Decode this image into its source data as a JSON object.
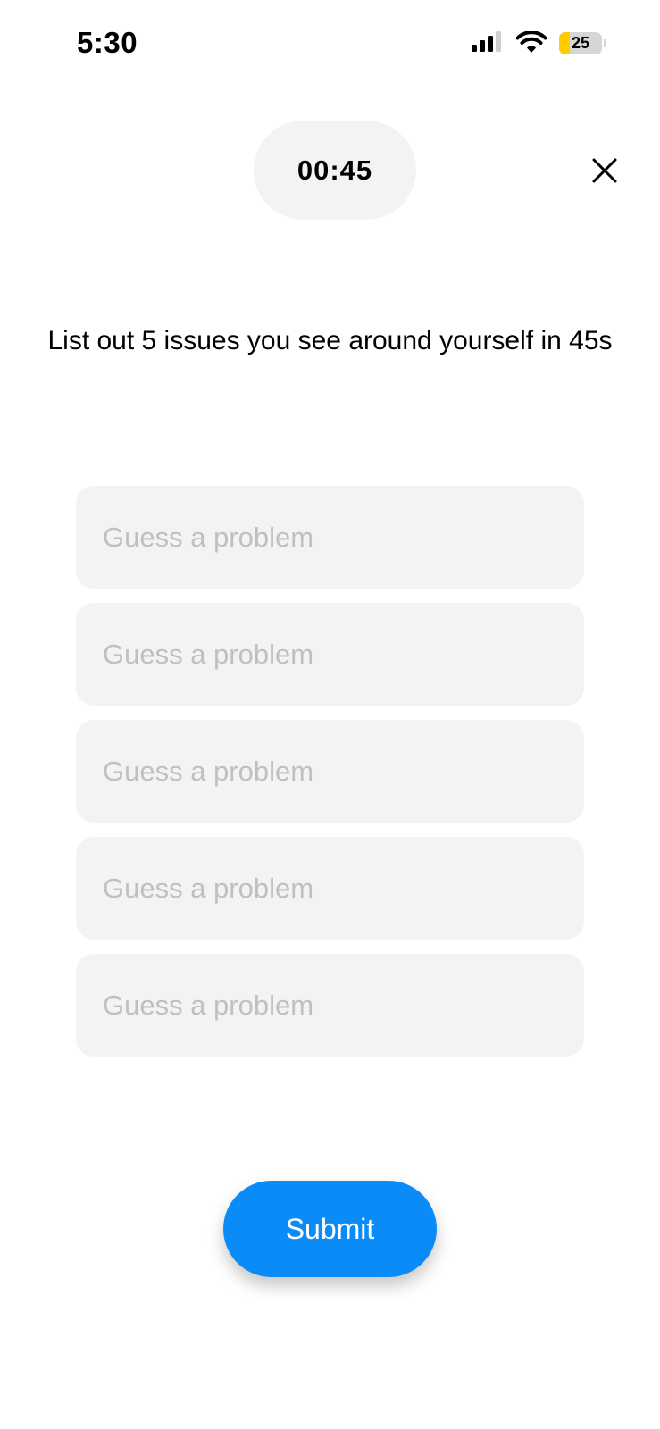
{
  "status_bar": {
    "time": "5:30",
    "signal_icon": "cellular-signal-icon",
    "wifi_icon": "wifi-icon",
    "battery_percent": 25,
    "battery_label": "25",
    "battery_color": "#ffcc00"
  },
  "timer": {
    "label": "00:45"
  },
  "close": {
    "icon": "close-icon"
  },
  "prompt": {
    "text": "List out 5 issues you see around yourself in 45s"
  },
  "inputs": [
    {
      "value": "",
      "placeholder": "Guess a problem"
    },
    {
      "value": "",
      "placeholder": "Guess a problem"
    },
    {
      "value": "",
      "placeholder": "Guess a problem"
    },
    {
      "value": "",
      "placeholder": "Guess a problem"
    },
    {
      "value": "",
      "placeholder": "Guess a problem"
    }
  ],
  "submit": {
    "label": "Submit",
    "color": "#0a8cf8"
  }
}
